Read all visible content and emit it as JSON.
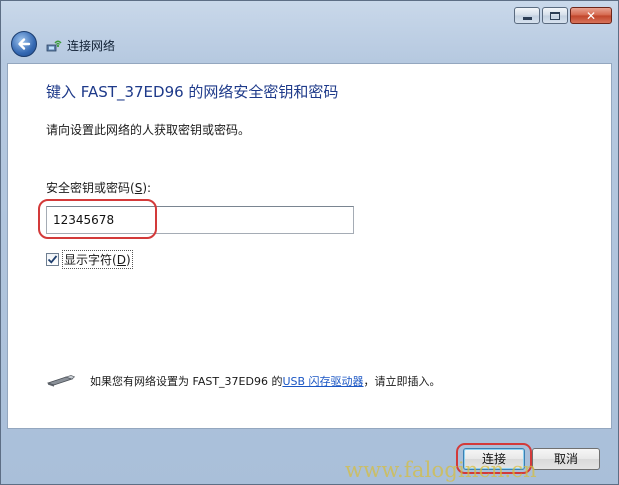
{
  "nav": {
    "title": "连接网络"
  },
  "main": {
    "heading": "键入 FAST_37ED96 的网络安全密钥和密码",
    "subtext": "请向设置此网络的人获取密钥或密码。",
    "key_label_prefix": "安全密钥或密码(",
    "key_label_accel": "S",
    "key_label_suffix": "):",
    "key_value": "12345678",
    "show_chars_checked": true,
    "show_chars_prefix": "显示字符(",
    "show_chars_accel": "D",
    "show_chars_suffix": ")",
    "usb_text_before": "如果您有网络设置为 FAST_37ED96 的 ",
    "usb_link": "USB 闪存驱动器",
    "usb_text_after": "，请立即插入。"
  },
  "footer": {
    "connect_label": "连接",
    "cancel_label": "取消"
  },
  "watermark": "www.falogincn.cn",
  "colors": {
    "heading": "#1e3a8a",
    "link": "#1a56c4",
    "annotation_ring": "#d33a3a",
    "close_button": "#c0442a"
  },
  "icons": {
    "back": "back-arrow-icon",
    "network": "network-icon",
    "usb": "usb-drive-icon",
    "minimize": "minimize-icon",
    "maximize": "maximize-icon",
    "close": "close-icon",
    "checkbox": "checkmark-icon"
  }
}
